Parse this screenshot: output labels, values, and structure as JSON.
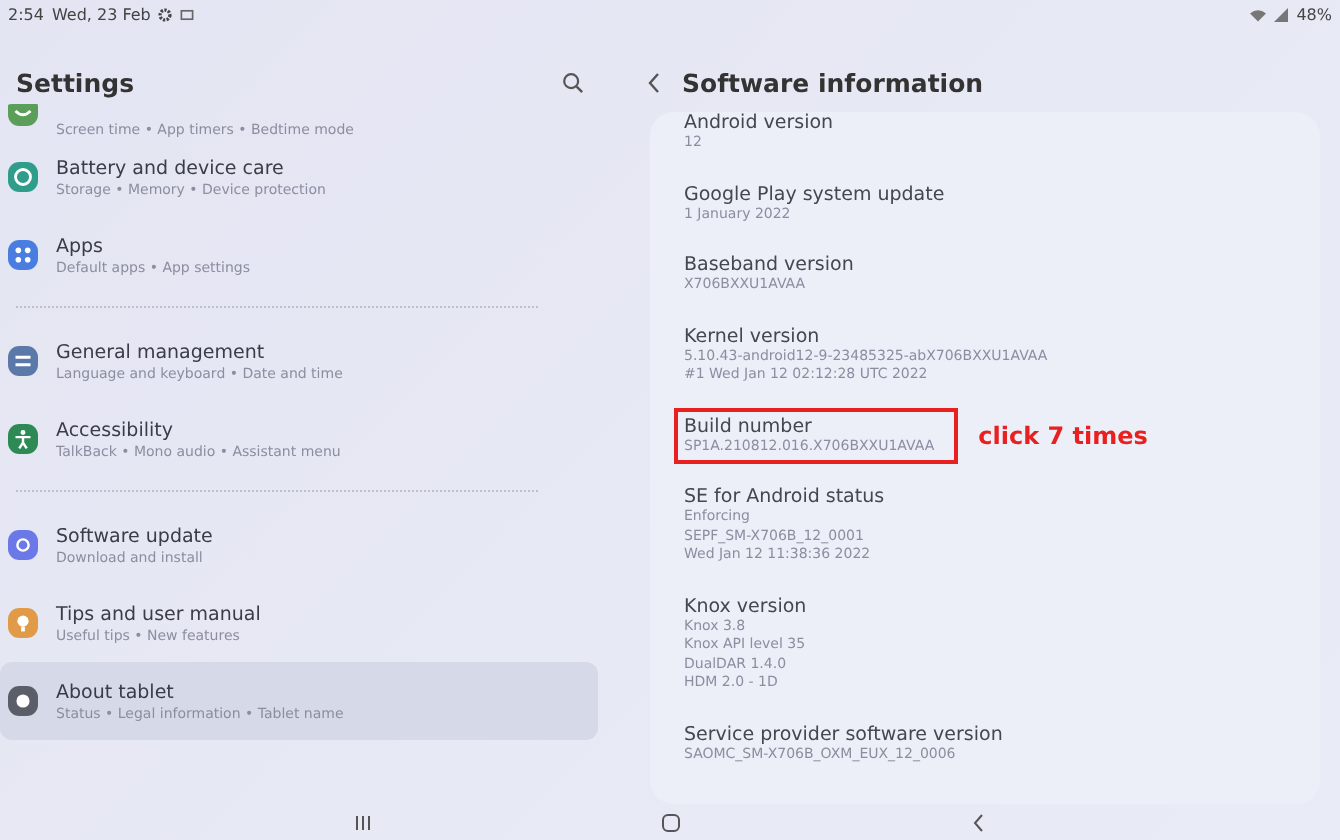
{
  "status_bar": {
    "time": "2:54",
    "date": "Wed, 23 Feb",
    "battery": "48%"
  },
  "settings": {
    "title": "Settings",
    "groups": [
      {
        "items": [
          {
            "kind": "wellbeing",
            "subtitle": "Screen time • App timers • Bedtime mode",
            "selected": false
          },
          {
            "kind": "battery",
            "title": "Battery and device care",
            "subtitle": "Storage • Memory • Device protection",
            "selected": false
          },
          {
            "kind": "apps",
            "title": "Apps",
            "subtitle": "Default apps • App settings",
            "selected": false
          }
        ]
      },
      {
        "items": [
          {
            "kind": "general",
            "title": "General management",
            "subtitle": "Language and keyboard • Date and time",
            "selected": false
          },
          {
            "kind": "accessibility",
            "title": "Accessibility",
            "subtitle": "TalkBack • Mono audio • Assistant menu",
            "selected": false
          }
        ]
      },
      {
        "items": [
          {
            "kind": "update",
            "title": "Software update",
            "subtitle": "Download and install",
            "selected": false
          },
          {
            "kind": "tips",
            "title": "Tips and user manual",
            "subtitle": "Useful tips • New features",
            "selected": false
          },
          {
            "kind": "about",
            "title": "About tablet",
            "subtitle": "Status • Legal information • Tablet name",
            "selected": true
          }
        ]
      }
    ]
  },
  "software_information": {
    "title": "Software information",
    "items": [
      {
        "title": "Android version",
        "lines": [
          "12"
        ],
        "highlighted": false
      },
      {
        "title": "Google Play system update",
        "lines": [
          "1 January 2022"
        ],
        "highlighted": false
      },
      {
        "title": "Baseband version",
        "lines": [
          "X706BXXU1AVAA"
        ],
        "highlighted": false
      },
      {
        "title": "Kernel version",
        "lines": [
          "5.10.43-android12-9-23485325-abX706BXXU1AVAA",
          "#1 Wed Jan 12 02:12:28 UTC 2022"
        ],
        "highlighted": false
      },
      {
        "title": "Build number",
        "lines": [
          "SP1A.210812.016.X706BXXU1AVAA"
        ],
        "highlighted": true,
        "annotation": "click 7 times"
      },
      {
        "title": "SE for Android status",
        "lines": [
          "Enforcing",
          "SEPF_SM-X706B_12_0001",
          "Wed Jan 12 11:38:36 2022"
        ],
        "highlighted": false
      },
      {
        "title": "Knox version",
        "lines": [
          "Knox 3.8",
          "Knox API level 35",
          "DualDAR 1.4.0",
          "HDM 2.0 - 1D"
        ],
        "highlighted": false
      },
      {
        "title": "Service provider software version",
        "lines": [
          "SAOMC_SM-X706B_OXM_EUX_12_0006"
        ],
        "highlighted": false
      }
    ]
  }
}
